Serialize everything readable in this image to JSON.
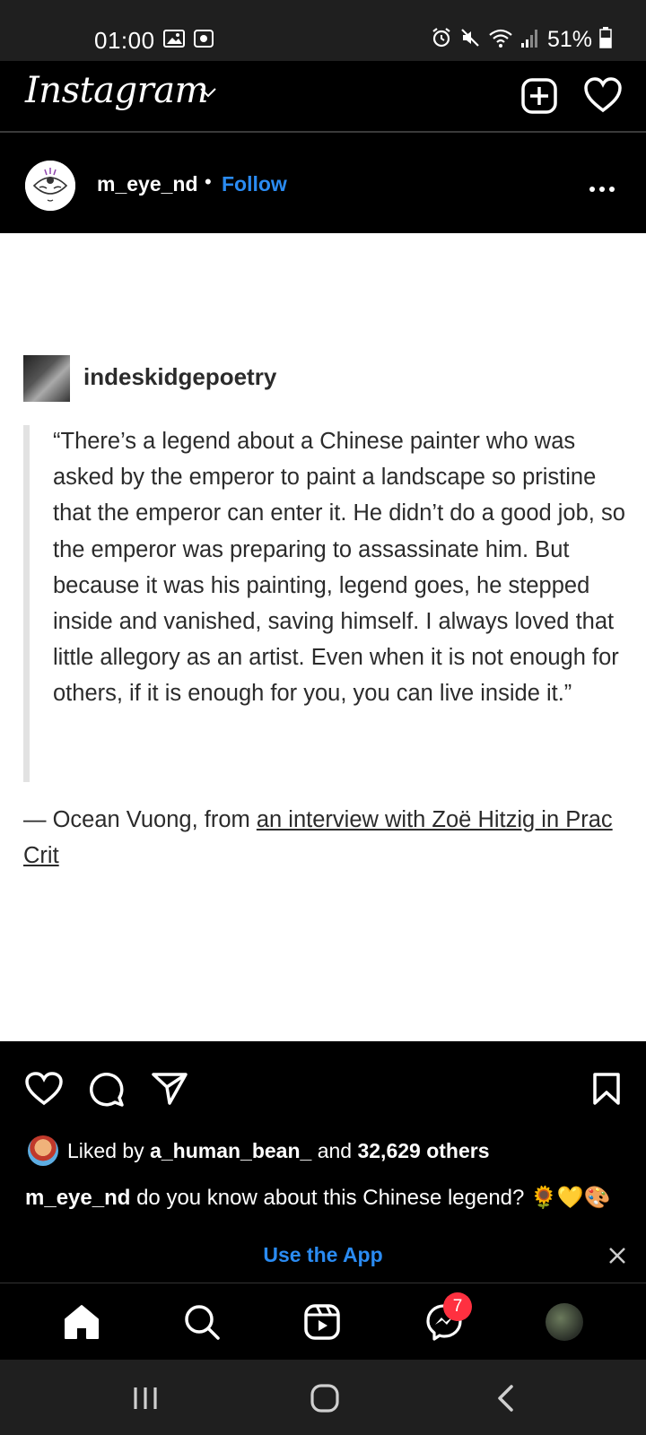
{
  "status_bar": {
    "time": "01:00",
    "battery": "51%",
    "icons": [
      "gallery-icon",
      "screen-record-icon",
      "alarm-icon",
      "mute-icon",
      "wifi-icon",
      "signal-icon",
      "battery-icon"
    ]
  },
  "header": {
    "app_name": "Instagram",
    "icons": [
      "chevron-down-icon",
      "new-post-icon",
      "heart-icon"
    ]
  },
  "post": {
    "username": "m_eye_nd",
    "separator": "•",
    "follow_label": "Follow",
    "image": {
      "tumblr_user": "indeskidgepoetry",
      "quote": "“There’s a legend about a Chinese painter who was asked by the emperor to paint a landscape so pristine that the emperor can enter it. He didn’t do a good job, so the emperor was preparing to assassinate him. But because it was his painting, legend goes, he stepped inside and vanished, saving himself. I always loved that little allegory as an artist. Even when it is not enough for others, if it is enough for you, you can live inside it.”",
      "attribution_prefix": "— Ocean Vuong, from ",
      "attribution_link": "an interview with Zoë Hitzig in Prac Crit"
    },
    "liked_by_prefix": "Liked by ",
    "liked_by_user": "a_human_bean_",
    "liked_by_middle": " and ",
    "liked_by_count": "32,629 others",
    "caption_user": "m_eye_nd",
    "caption_text": " do you know about this Chinese legend? 🌻💛🎨"
  },
  "banner": {
    "use_app_label": "Use the App"
  },
  "bottom_nav": {
    "items": [
      "home",
      "search",
      "reels",
      "messenger",
      "profile"
    ],
    "messenger_badge": "7"
  },
  "colors": {
    "accent": "#2a8bf2",
    "badge": "#ff3040",
    "background": "#000000"
  }
}
